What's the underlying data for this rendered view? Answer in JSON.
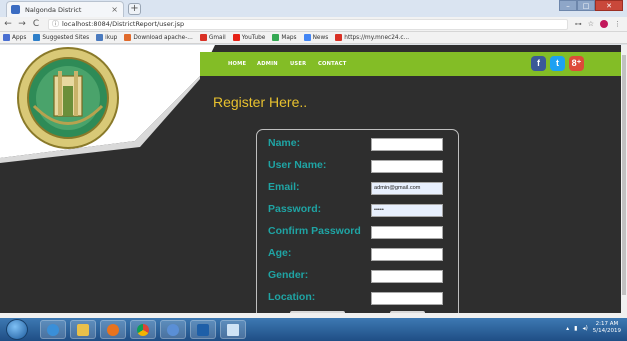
{
  "browser": {
    "tab_title": "Nalgonda District",
    "tab_close": "×",
    "new_tab": "+",
    "url": "localhost:8084/DistrictReport/user.jsp",
    "nav_back": "←",
    "nav_forward": "→",
    "nav_reload": "C",
    "url_info": "ⓘ",
    "bookmarks": [
      {
        "label": "Apps",
        "color": "#4a6fd1"
      },
      {
        "label": "Suggested Sites",
        "color": "#2e7fc9"
      },
      {
        "label": "ikup",
        "color": "#4b7bbf"
      },
      {
        "label": "Download apache-...",
        "color": "#e06a2c"
      },
      {
        "label": "Gmail",
        "color": "#d93025"
      },
      {
        "label": "YouTube",
        "color": "#e62117"
      },
      {
        "label": "Maps",
        "color": "#34a853"
      },
      {
        "label": "News",
        "color": "#4285f4"
      },
      {
        "label": "https://my.mnec24.c...",
        "color": "#d93025"
      }
    ]
  },
  "site": {
    "nav": [
      "HOME",
      "ADMIN",
      "USER",
      "CONTACT"
    ],
    "social": [
      {
        "glyph": "f",
        "color": "#3b5998"
      },
      {
        "glyph": "t",
        "color": "#1da1f2"
      },
      {
        "glyph": "8⁺",
        "color": "#dd4b39"
      }
    ],
    "accent": "#83bd26"
  },
  "form": {
    "title": "Register Here..",
    "fields": [
      {
        "label": "Name:",
        "value": ""
      },
      {
        "label": "User Name:",
        "value": ""
      },
      {
        "label": "Email:",
        "value": "admin@gmail.com"
      },
      {
        "label": "Password:",
        "value": "•••••"
      },
      {
        "label": "Confirm Password",
        "value": ""
      },
      {
        "label": "Age:",
        "value": ""
      },
      {
        "label": "Gender:",
        "value": ""
      },
      {
        "label": "Location:",
        "value": ""
      }
    ]
  },
  "taskbar": {
    "time": "2:17 AM",
    "date": "5/14/2019"
  }
}
